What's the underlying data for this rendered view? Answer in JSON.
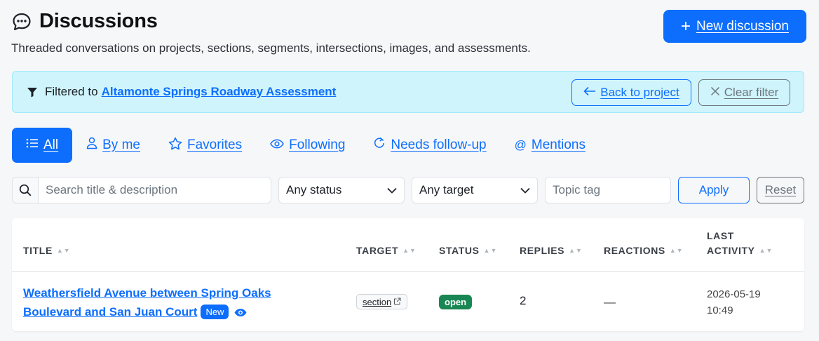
{
  "header": {
    "title": "Discussions",
    "subtitle": "Threaded conversations on projects, sections, segments, intersections, images, and assessments.",
    "new_button_label": "New discussion"
  },
  "filter_banner": {
    "prefix": "Filtered to",
    "project_name": "Altamonte Springs Roadway Assessment",
    "back_label": "Back to project",
    "clear_label": "Clear filter"
  },
  "tabs": [
    {
      "label": "All",
      "icon": "list-icon",
      "active": true
    },
    {
      "label": "By me",
      "icon": "person-icon",
      "active": false
    },
    {
      "label": "Favorites",
      "icon": "star-icon",
      "active": false
    },
    {
      "label": "Following",
      "icon": "eye-icon",
      "active": false
    },
    {
      "label": "Needs follow-up",
      "icon": "refresh-icon",
      "active": false
    },
    {
      "label": "Mentions",
      "icon": "at-icon",
      "active": false
    }
  ],
  "filters": {
    "search_placeholder": "Search title & description",
    "status_value": "Any status",
    "target_value": "Any target",
    "tag_placeholder": "Topic tag",
    "apply_label": "Apply",
    "reset_label": "Reset"
  },
  "table": {
    "columns": {
      "title": "TITLE",
      "target": "TARGET",
      "status": "STATUS",
      "replies": "REPLIES",
      "reactions": "REACTIONS",
      "last_activity_1": "LAST",
      "last_activity_2": "ACTIVITY"
    },
    "rows": [
      {
        "title": "Weathersfield Avenue between Spring Oaks Boulevard and San Juan Court",
        "badge": "New",
        "target": "section",
        "status": "open",
        "replies": "2",
        "reactions": "—",
        "last_activity_date": "2026-05-19",
        "last_activity_time": "10:49"
      }
    ]
  },
  "colors": {
    "primary": "#0d6efd",
    "banner_bg": "#cff4fc",
    "status_open": "#198754",
    "secondary": "#6c757d"
  }
}
